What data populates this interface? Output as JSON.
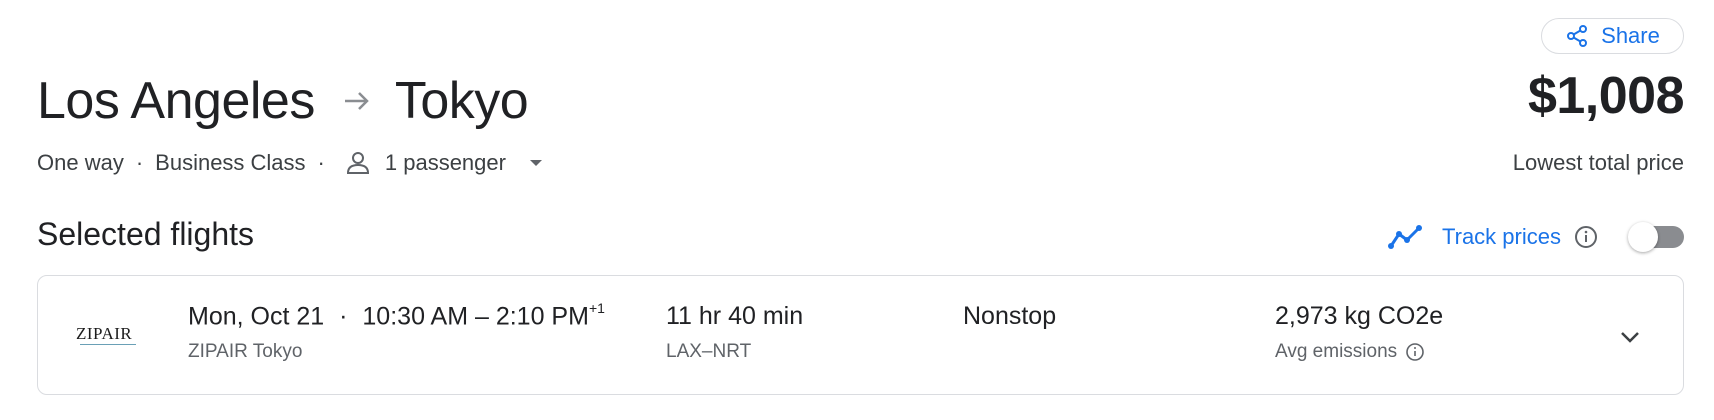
{
  "header": {
    "share_label": "Share",
    "origin": "Los Angeles",
    "destination": "Tokyo",
    "price": "$1,008",
    "price_caption": "Lowest total price"
  },
  "trip": {
    "type": "One way",
    "separator": "·",
    "cabin": "Business Class",
    "passengers": "1 passenger"
  },
  "section": {
    "title": "Selected flights",
    "track_label": "Track prices",
    "track_enabled": false
  },
  "flight": {
    "logo_text": "ZIPAIR",
    "date": "Mon, Oct 21",
    "separator": "·",
    "times": "10:30 AM – 2:10 PM",
    "day_offset": "+1",
    "airline": "ZIPAIR Tokyo",
    "duration": "11 hr 40 min",
    "route": "LAX–NRT",
    "stops": "Nonstop",
    "emissions": "2,973 kg CO2e",
    "emissions_label": "Avg emissions"
  },
  "icons": {
    "share": "share-icon",
    "arrow": "arrow-right-icon",
    "passenger": "person-icon",
    "dropdown": "caret-down-icon",
    "track": "trend-line-icon",
    "info": "info-icon",
    "expand": "chevron-down-icon"
  },
  "colors": {
    "accent": "#1a73e8",
    "text": "#202124",
    "secondary_text": "#5f6368",
    "border": "#dadce0"
  }
}
